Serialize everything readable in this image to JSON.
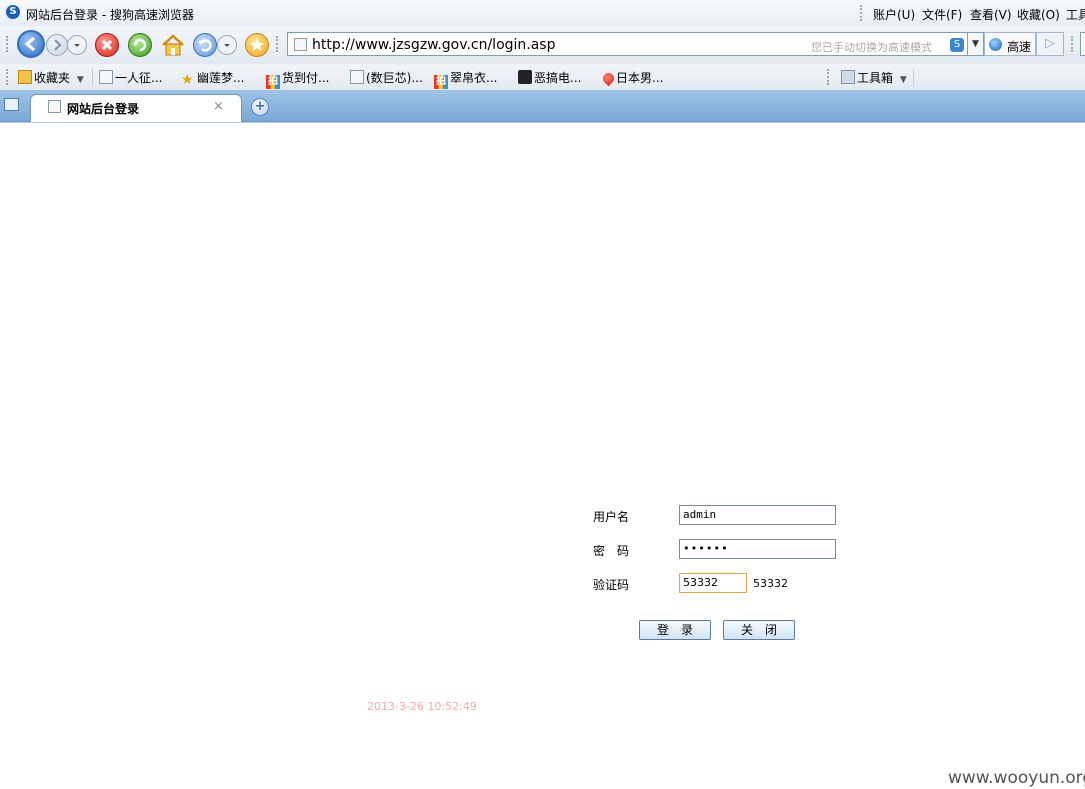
{
  "window": {
    "title": "网站后台登录 - 搜狗高速浏览器",
    "menu": [
      "账户(U)",
      "文件(F)",
      "查看(V)",
      "收藏(O)",
      "工具"
    ]
  },
  "addressbar": {
    "url": "http://www.jzsgzw.gov.cn/login.asp",
    "hint": "您已手动切换为高速模式",
    "speed_label": "高速"
  },
  "bookmarks": {
    "items": [
      "收藏夹",
      "一人征...",
      "幽莲梦...",
      "货到付...",
      "(数巨芯)...",
      "翠帛衣...",
      "恶搞电...",
      "日本男..."
    ],
    "tools_label": "工具箱"
  },
  "tab": {
    "title": "网站后台登录",
    "close": "×",
    "new": "+"
  },
  "login": {
    "username_label": "用户名",
    "username_value": "admin",
    "password_label": "密　码",
    "password_value": "••••••",
    "captcha_label": "验证码",
    "captcha_value": "53332",
    "captcha_code": "53332",
    "login_button": "登　录",
    "close_button": "关　闭"
  },
  "timestamp": "2013-3-26 10:52:49",
  "watermark": "www.wooyun.org",
  "colors": {
    "tabbar": "#8fb8e0",
    "timestamp": "#f4aaaa",
    "captcha_border": "#d9a84e"
  }
}
